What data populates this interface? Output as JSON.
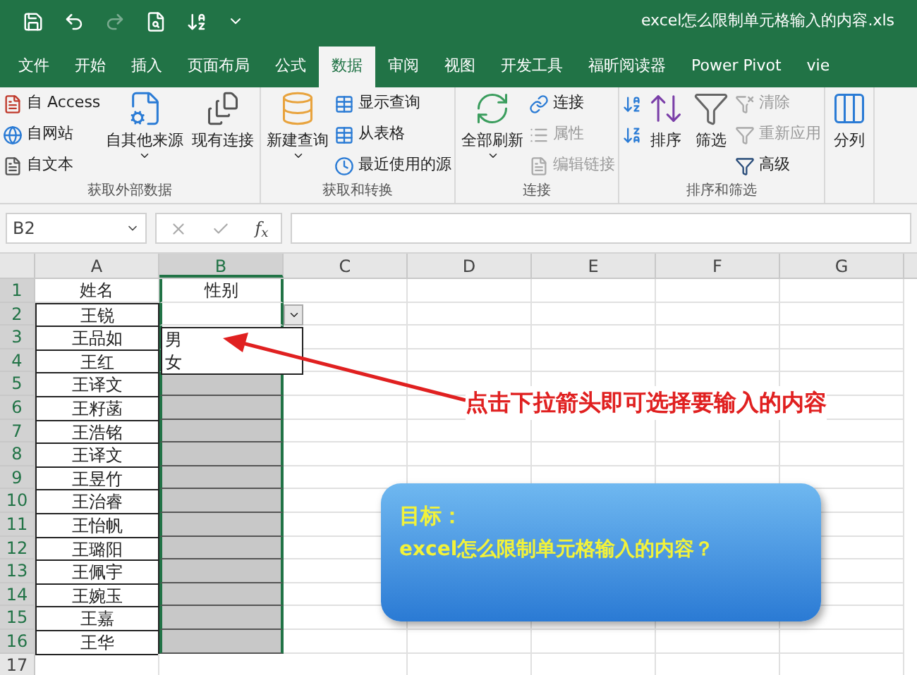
{
  "title_bar": {
    "title": "excel怎么限制单元格输入的内容.xls"
  },
  "tabs": [
    {
      "label": "文件",
      "selected": false
    },
    {
      "label": "开始",
      "selected": false
    },
    {
      "label": "插入",
      "selected": false
    },
    {
      "label": "页面布局",
      "selected": false
    },
    {
      "label": "公式",
      "selected": false
    },
    {
      "label": "数据",
      "selected": true
    },
    {
      "label": "审阅",
      "selected": false
    },
    {
      "label": "视图",
      "selected": false
    },
    {
      "label": "开发工具",
      "selected": false
    },
    {
      "label": "福昕阅读器",
      "selected": false
    },
    {
      "label": "Power Pivot",
      "selected": false
    },
    {
      "label": "vie",
      "selected": false
    }
  ],
  "ribbon_groups": [
    {
      "label": "获取外部数据",
      "columns": [
        [
          {
            "kind": "small",
            "label": "自 Access",
            "disabled": false
          },
          {
            "kind": "small",
            "label": "自网站",
            "disabled": false
          },
          {
            "kind": "small",
            "label": "自文本",
            "disabled": false
          }
        ],
        [
          {
            "kind": "large",
            "label": "自其他来源",
            "caret": true,
            "disabled": false
          }
        ],
        [
          {
            "kind": "large",
            "label": "现有连接",
            "caret": false,
            "disabled": false
          }
        ]
      ]
    },
    {
      "label": "获取和转换",
      "columns": [
        [
          {
            "kind": "large",
            "label": "新建查询",
            "caret": true,
            "disabled": false
          }
        ],
        [
          {
            "kind": "small",
            "label": "显示查询",
            "disabled": false
          },
          {
            "kind": "small",
            "label": "从表格",
            "disabled": false
          },
          {
            "kind": "small",
            "label": "最近使用的源",
            "disabled": false
          }
        ]
      ]
    },
    {
      "label": "连接",
      "columns": [
        [
          {
            "kind": "large",
            "label": "全部刷新",
            "caret": true,
            "disabled": false
          }
        ],
        [
          {
            "kind": "small",
            "label": "连接",
            "disabled": false
          },
          {
            "kind": "small",
            "label": "属性",
            "disabled": true
          },
          {
            "kind": "small",
            "label": "编辑链接",
            "disabled": true
          }
        ]
      ]
    },
    {
      "label": "排序和筛选",
      "columns": [
        [
          {
            "kind": "small",
            "disabled": false
          },
          {
            "kind": "small",
            "disabled": false
          }
        ],
        [
          {
            "kind": "large",
            "label": "排序",
            "caret": false,
            "disabled": false
          }
        ],
        [
          {
            "kind": "large",
            "label": "筛选",
            "caret": false,
            "disabled": false
          }
        ],
        [
          {
            "kind": "small",
            "label": "清除",
            "disabled": true
          },
          {
            "kind": "small",
            "label": "重新应用",
            "disabled": true
          },
          {
            "kind": "small",
            "label": "高级",
            "disabled": false
          }
        ]
      ]
    },
    {
      "columns": [
        [
          {
            "kind": "large",
            "label": "分列",
            "caret": false,
            "disabled": false
          }
        ]
      ]
    }
  ],
  "formula_bar": {
    "name_box": "B2",
    "function_label": "f$_{x}$"
  },
  "columns": [
    {
      "label": "A",
      "selected": false
    },
    {
      "label": "B",
      "selected": true
    },
    {
      "label": "C",
      "selected": false
    },
    {
      "label": "D",
      "selected": false
    },
    {
      "label": "E",
      "selected": false
    },
    {
      "label": "F",
      "selected": false
    },
    {
      "label": "G",
      "selected": false
    }
  ],
  "rows": [
    {
      "number": "1",
      "name": "姓名",
      "gender": "性别",
      "shaded": false,
      "selected": true
    },
    {
      "number": "2",
      "name": "王锐",
      "shaded": false,
      "selected": true
    },
    {
      "number": "3",
      "name": "王品如",
      "shaded": false,
      "selected": true
    },
    {
      "number": "4",
      "name": "王红",
      "shaded": false,
      "selected": true
    },
    {
      "number": "5",
      "name": "王译文",
      "shaded": true,
      "selected": true
    },
    {
      "number": "6",
      "name": "王籽菡",
      "shaded": true,
      "selected": true
    },
    {
      "number": "7",
      "name": "王浩铭",
      "shaded": true,
      "selected": true
    },
    {
      "number": "8",
      "name": "王译文",
      "shaded": true,
      "selected": true
    },
    {
      "number": "9",
      "name": "王昱竹",
      "shaded": true,
      "selected": true
    },
    {
      "number": "10",
      "name": "王治睿",
      "shaded": true,
      "selected": true
    },
    {
      "number": "11",
      "name": "王怡帆",
      "shaded": true,
      "selected": true
    },
    {
      "number": "12",
      "name": "王璐阳",
      "shaded": true,
      "selected": true
    },
    {
      "number": "13",
      "name": "王佩宇",
      "shaded": true,
      "selected": true
    },
    {
      "number": "14",
      "name": "王婉玉",
      "shaded": true,
      "selected": true
    },
    {
      "number": "15",
      "name": "王嘉",
      "shaded": true,
      "selected": true
    },
    {
      "number": "16",
      "name": "王华",
      "shaded": true,
      "selected": true
    },
    {
      "number": "17",
      "shaded": false,
      "selected": false
    }
  ],
  "dropdown": {
    "options": [
      "男",
      "女"
    ]
  },
  "annotation": {
    "text": "点击下拉箭头即可选择要输入的内容"
  },
  "callout": {
    "title": "目标：",
    "text": "excel怎么限制单元格输入的内容？"
  }
}
